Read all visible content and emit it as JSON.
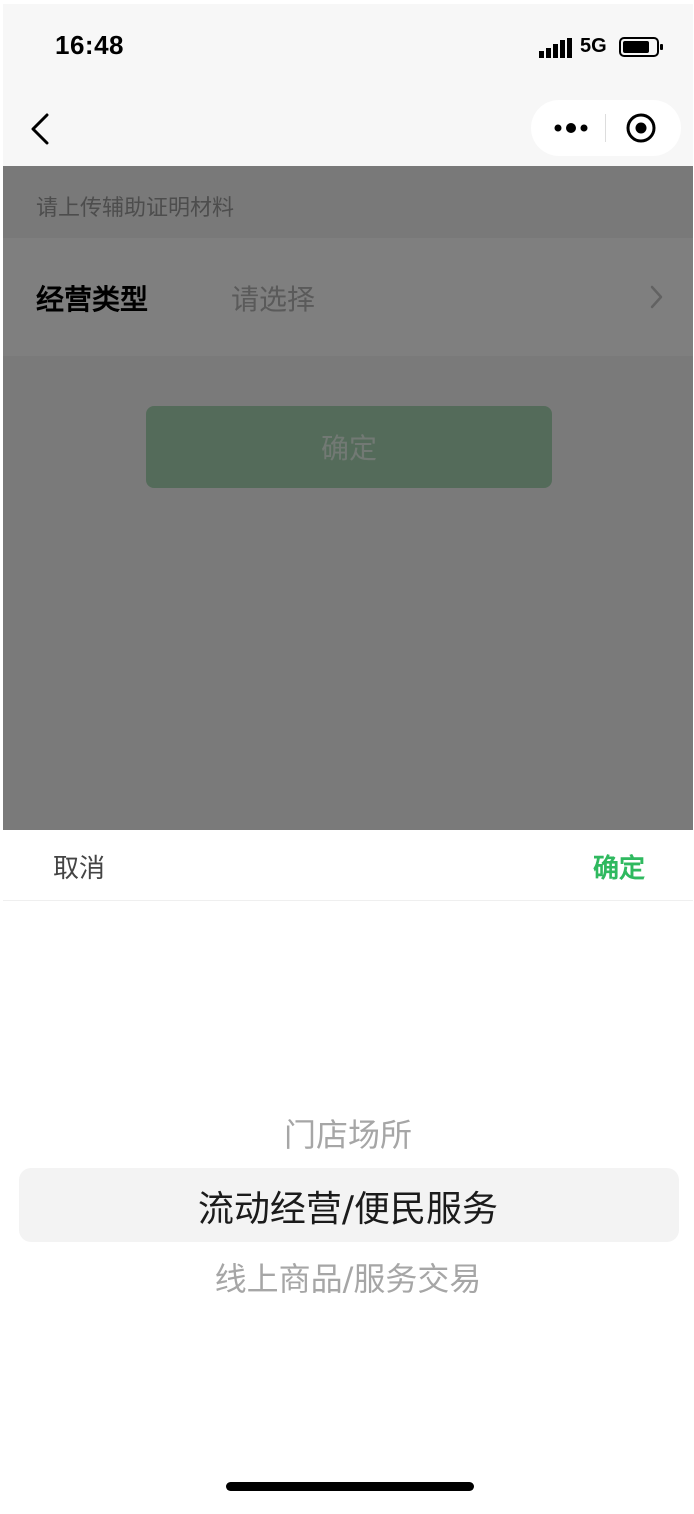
{
  "status_bar": {
    "time": "16:48",
    "network": "5G",
    "signal_icon": "signal-bars-icon",
    "battery_icon": "battery-icon"
  },
  "nav": {
    "back_icon": "chevron-left-icon",
    "more_icon": "more-dots-icon",
    "close_icon": "target-close-icon"
  },
  "form": {
    "hint": "请上传辅助证明材料",
    "business_type_label": "经营类型",
    "business_type_placeholder": "请选择",
    "arrow_icon": "chevron-right-icon",
    "confirm_label": "确定"
  },
  "picker": {
    "cancel_label": "取消",
    "confirm_label": "确定",
    "options": [
      "门店场所",
      "流动经营/便民服务",
      "线上商品/服务交易"
    ],
    "selected": "流动经营/便民服务"
  },
  "colors": {
    "accent_green": "#2fb95f",
    "button_green_masked": "#a9d7b4",
    "mask": "rgba(0,0,0,0.5)"
  }
}
